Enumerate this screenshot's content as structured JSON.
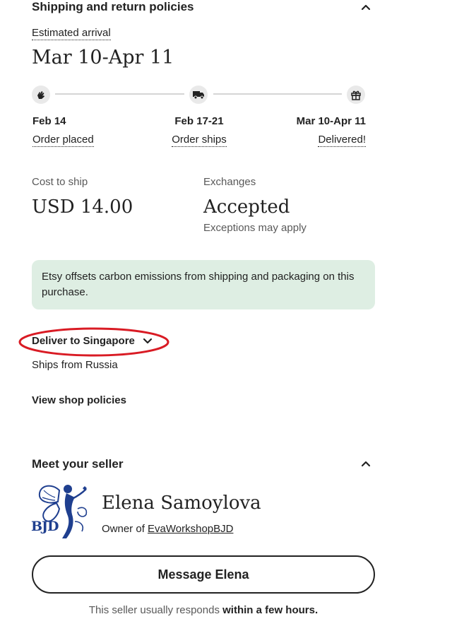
{
  "shipping": {
    "title": "Shipping and return policies",
    "estimated_arrival_label": "Estimated arrival",
    "estimated_arrival_value": "Mar 10-Apr 11",
    "timeline": [
      {
        "date": "Feb 14",
        "label": "Order placed",
        "icon": "hand-icon"
      },
      {
        "date": "Feb 17-21",
        "label": "Order ships",
        "icon": "truck-icon"
      },
      {
        "date": "Mar 10-Apr 11",
        "label": "Delivered!",
        "icon": "gift-icon"
      }
    ],
    "cost_label": "Cost to ship",
    "cost_value": "USD 14.00",
    "exchanges_label": "Exchanges",
    "exchanges_value": "Accepted",
    "exchanges_note": "Exceptions may apply",
    "carbon_note": "Etsy offsets carbon emissions from shipping and packaging on this purchase.",
    "deliver_to": "Deliver to Singapore",
    "ships_from": "Ships from Russia",
    "view_policies": "View shop policies"
  },
  "seller": {
    "title": "Meet your seller",
    "name": "Elena Samoylova",
    "owner_prefix": "Owner of ",
    "shop_name": "EvaWorkshopBJD",
    "logo_text": "BJD",
    "message_button": "Message Elena",
    "response_prefix": "This seller usually responds ",
    "response_time": "within a few hours."
  },
  "colors": {
    "banner_bg": "#deeee3",
    "annotation_circle": "#d91b24",
    "logo_blue": "#1f3f8f"
  }
}
